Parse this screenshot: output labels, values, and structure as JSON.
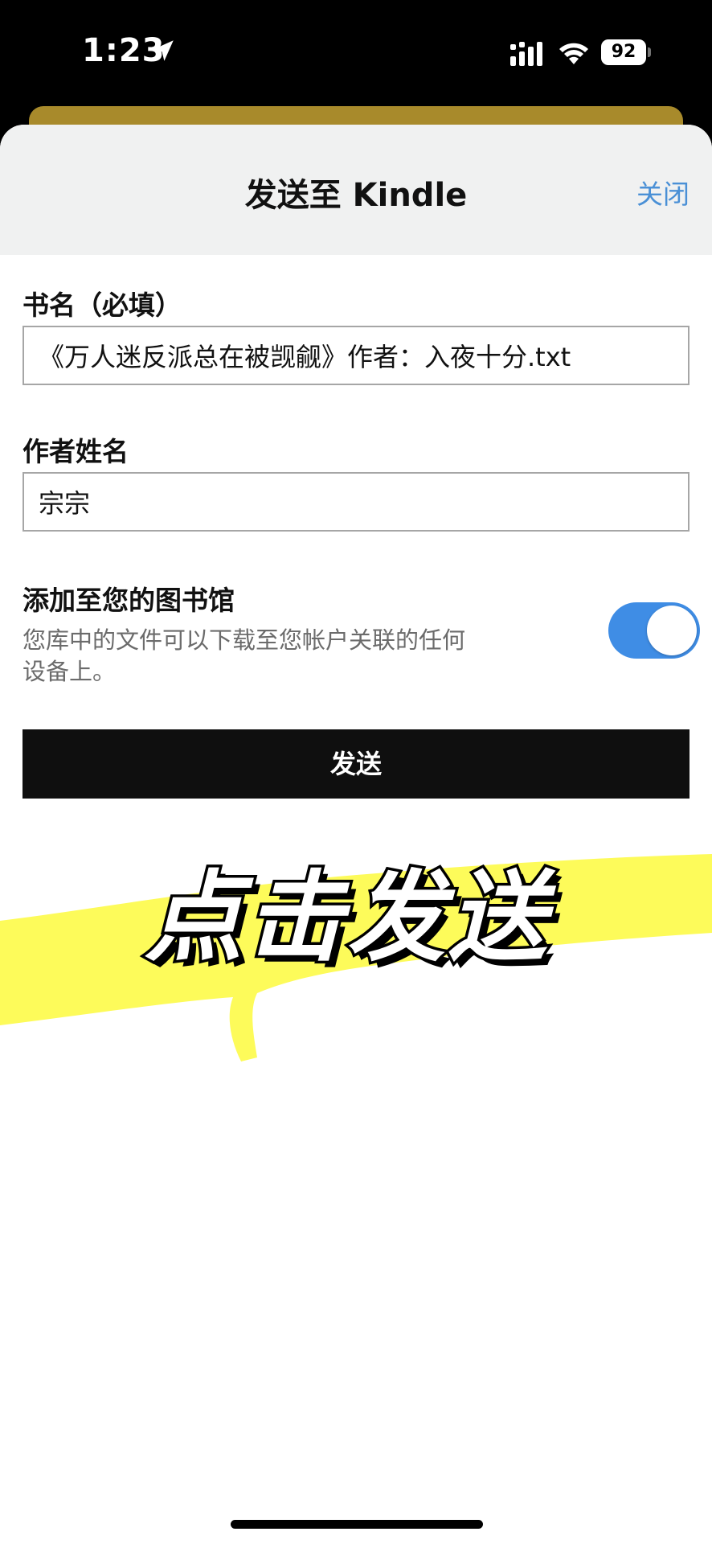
{
  "status_bar": {
    "time": "1:23",
    "battery": "92"
  },
  "sheet": {
    "title": "发送至 Kindle",
    "close_label": "关闭",
    "book_title_label": "书名（必填）",
    "book_title_value": "《万人迷反派总在被觊觎》作者：入夜十分.txt",
    "author_label": "作者姓名",
    "author_value": "宗宗",
    "library_title": "添加至您的图书馆",
    "library_desc": "您库中的文件可以下载至您帐户关联的任何设备上。",
    "library_toggle_on": true,
    "send_label": "发送"
  },
  "overlay": {
    "caption": "点击发送",
    "highlight_color": "#fdfb5a"
  },
  "colors": {
    "accent": "#3f8de5",
    "link": "#4a90d6",
    "button": "#0f0f0f"
  }
}
